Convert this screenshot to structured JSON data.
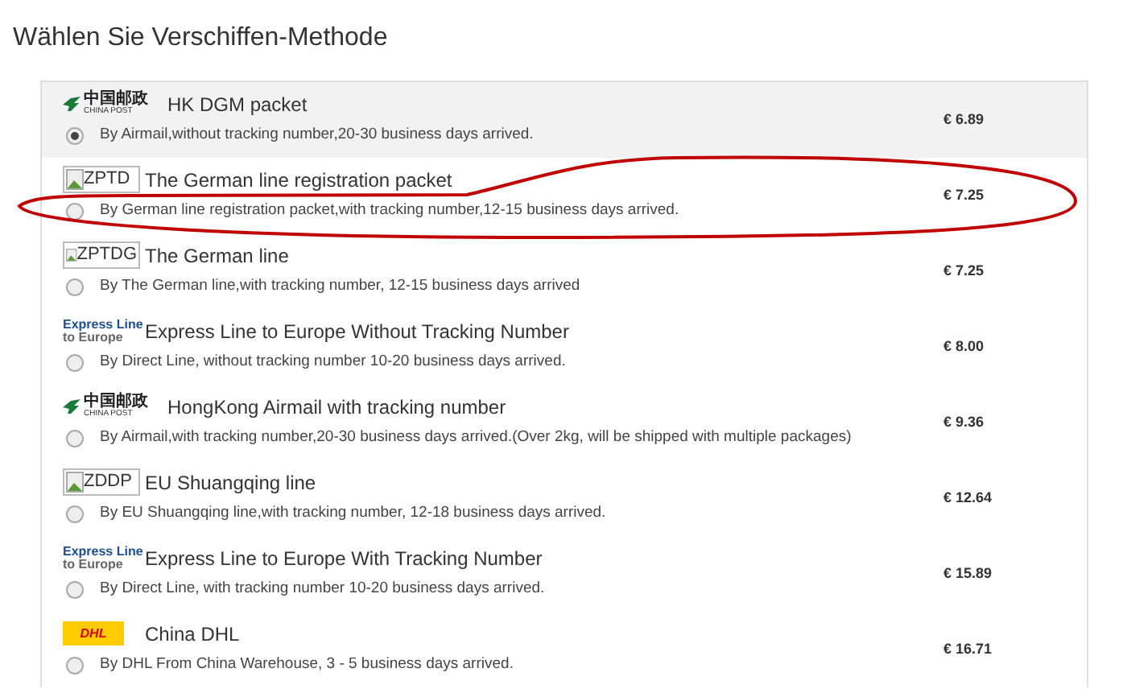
{
  "heading": "Wählen Sie Verschiffen-Methode",
  "methods": [
    {
      "logo": {
        "kind": "china_post",
        "lines": [
          "中国邮政",
          "CHINA POST"
        ]
      },
      "name": "HK DGM packet",
      "description": "By Airmail,without tracking number,20-30 business days arrived.",
      "price": "€ 6.89",
      "selected": true
    },
    {
      "logo": {
        "kind": "broken_image",
        "lines": [
          "ZPTD"
        ]
      },
      "name": "The German line registration packet",
      "description": "By German line registration packet,with tracking number,12-15 business days arrived.",
      "price": "€ 7.25",
      "selected": false,
      "circled": true
    },
    {
      "logo": {
        "kind": "broken_image",
        "lines": [
          "ZPTDG"
        ]
      },
      "name": "The German line",
      "description": "By The German line,with tracking number, 12-15 business days arrived",
      "price": "€ 7.25",
      "selected": false
    },
    {
      "logo": {
        "kind": "express",
        "lines": [
          "Express Line",
          "to Europe"
        ]
      },
      "name": "Express Line to Europe Without Tracking Number",
      "description": "By Direct Line, without tracking number 10-20 business days arrived.",
      "price": "€ 8.00",
      "selected": false
    },
    {
      "logo": {
        "kind": "china_post",
        "lines": [
          "中国邮政",
          "CHINA POST"
        ]
      },
      "name": "HongKong Airmail with tracking number",
      "description": "By Airmail,with tracking number,20-30 business days arrived.(Over 2kg, will be shipped with multiple packages)",
      "price": "€ 9.36",
      "selected": false
    },
    {
      "logo": {
        "kind": "broken_image",
        "lines": [
          "ZDDP"
        ]
      },
      "name": "EU Shuangqing line",
      "description": "By EU Shuangqing line,with tracking number, 12-18 business days arrived.",
      "price": "€ 12.64",
      "selected": false
    },
    {
      "logo": {
        "kind": "express",
        "lines": [
          "Express Line",
          "to Europe"
        ]
      },
      "name": "Express Line to Europe With Tracking Number",
      "description": "By Direct Line, with tracking number 10-20 business days arrived.",
      "price": "€ 15.89",
      "selected": false
    },
    {
      "logo": {
        "kind": "dhl",
        "lines": [
          "DHL"
        ]
      },
      "name": "China DHL",
      "description": "By DHL From China Warehouse, 3 - 5 business days arrived.",
      "price": "€ 16.71",
      "selected": false
    }
  ]
}
